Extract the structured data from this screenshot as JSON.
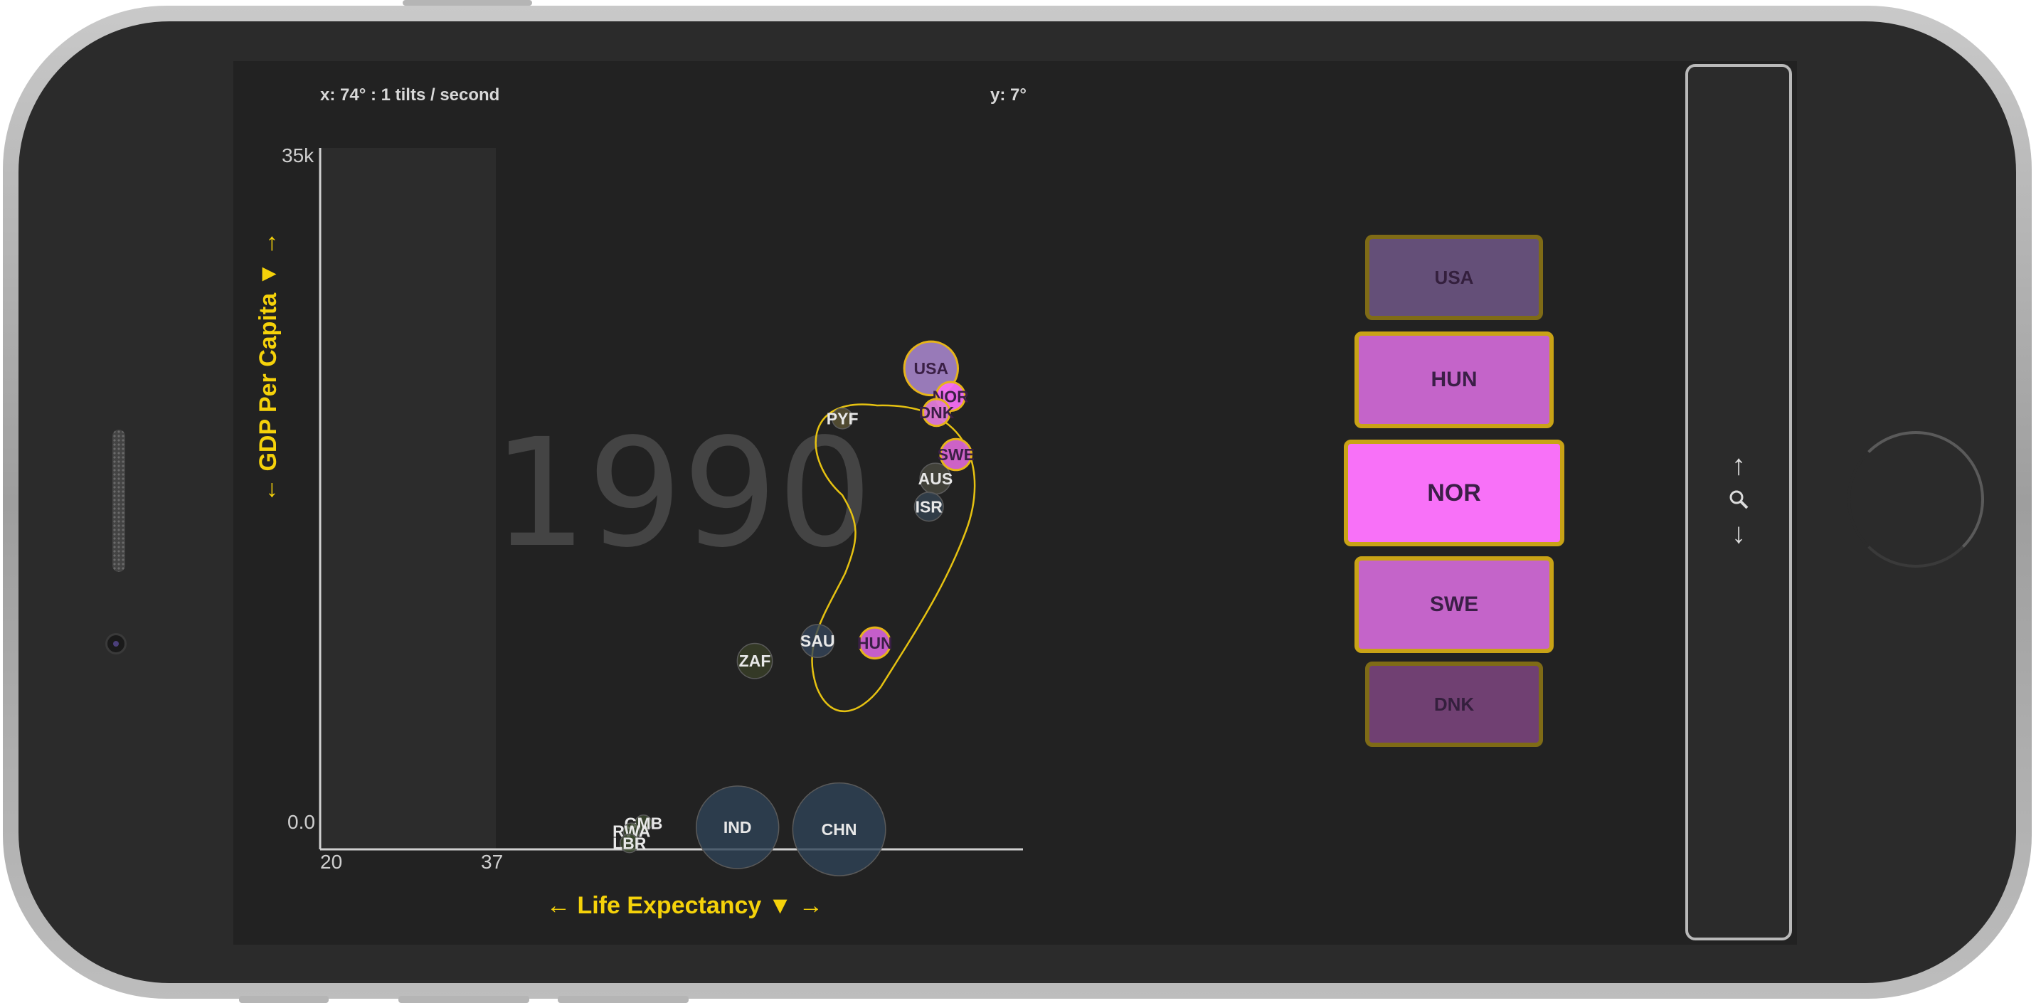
{
  "status": {
    "x_readout": "x: 74° : 1 tilts / second",
    "y_readout": "y: 7°"
  },
  "chart_data": {
    "type": "scatter",
    "year": "1990",
    "xlabel": "← Life Expectancy ▼ →",
    "ylabel": "← GDP Per Capita ▼ →",
    "x_ticks": [
      "20",
      "37"
    ],
    "y_ticks": [
      "35k",
      "0.0"
    ],
    "xlim": [
      20,
      85
    ],
    "ylim": [
      0,
      35000
    ],
    "shaded_x_range": [
      20,
      37
    ],
    "grid": false,
    "points": [
      {
        "label": "USA",
        "x": 76.5,
        "y": 24000,
        "r": 26,
        "color": "#9f7fc1",
        "selected": true
      },
      {
        "label": "NOR",
        "x": 78.3,
        "y": 22600,
        "r": 14,
        "color": "#f66ef6",
        "selected": true
      },
      {
        "label": "DNK",
        "x": 77.0,
        "y": 21800,
        "r": 13,
        "color": "#e07ad8",
        "selected": true
      },
      {
        "label": "SWE",
        "x": 78.8,
        "y": 19700,
        "r": 15,
        "color": "#d766d1",
        "selected": true
      },
      {
        "label": "HUN",
        "x": 71.3,
        "y": 10300,
        "r": 15,
        "color": "#cf62d3",
        "selected": true
      },
      {
        "label": "PYF",
        "x": 68.3,
        "y": 21500,
        "r": 10,
        "color": "#5c5536",
        "selected": false
      },
      {
        "label": "AUS",
        "x": 76.9,
        "y": 18500,
        "r": 15,
        "color": "#4a4a40",
        "selected": false
      },
      {
        "label": "ISR",
        "x": 76.3,
        "y": 17100,
        "r": 14,
        "color": "#344451",
        "selected": false
      },
      {
        "label": "SAU",
        "x": 66.0,
        "y": 10400,
        "r": 16,
        "color": "#34455a",
        "selected": false
      },
      {
        "label": "ZAF",
        "x": 60.2,
        "y": 9400,
        "r": 17,
        "color": "#3a4028",
        "selected": false
      },
      {
        "label": "IND",
        "x": 58.6,
        "y": 1100,
        "r": 40,
        "color": "#2f4457",
        "selected": false
      },
      {
        "label": "CHN",
        "x": 68.0,
        "y": 1000,
        "r": 45,
        "color": "#2f4457",
        "selected": false
      },
      {
        "label": "GMB",
        "x": 49.9,
        "y": 1300,
        "r": 8,
        "color": "#3c4a30",
        "selected": false
      },
      {
        "label": "RWA",
        "x": 48.8,
        "y": 900,
        "r": 8,
        "color": "#3c4a30",
        "selected": false
      },
      {
        "label": "LBR",
        "x": 48.6,
        "y": 300,
        "r": 9,
        "color": "#3c4a30",
        "selected": false
      }
    ]
  },
  "stack": {
    "items": [
      {
        "label": "USA",
        "color": "#7a5f95",
        "size": "small"
      },
      {
        "label": "HUN",
        "color": "#c464c9",
        "size": "medium"
      },
      {
        "label": "NOR",
        "color": "#f871f8",
        "size": "large"
      },
      {
        "label": "SWE",
        "color": "#c464c9",
        "size": "medium"
      },
      {
        "label": "DNK",
        "color": "#8a4a8d",
        "size": "small"
      }
    ]
  },
  "scroll_panel": {
    "up_glyph": "↑",
    "search_glyph": "🔍",
    "down_glyph": "↓"
  }
}
